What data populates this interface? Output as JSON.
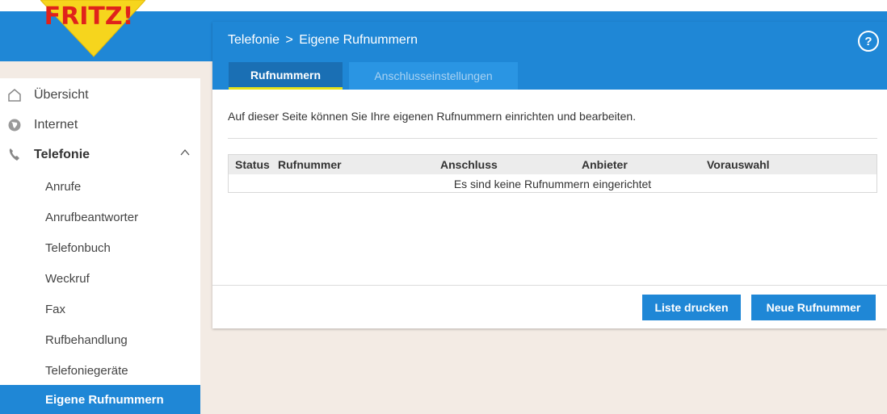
{
  "logo_text": "FRITZ!",
  "sidebar": {
    "items": [
      {
        "label": "Übersicht",
        "icon": "home-icon"
      },
      {
        "label": "Internet",
        "icon": "globe-icon"
      },
      {
        "label": "Telefonie",
        "icon": "phone-icon",
        "expanded": true
      }
    ],
    "sub_items": [
      {
        "label": "Anrufe"
      },
      {
        "label": "Anrufbeantworter"
      },
      {
        "label": "Telefonbuch"
      },
      {
        "label": "Weckruf"
      },
      {
        "label": "Fax"
      },
      {
        "label": "Rufbehandlung"
      },
      {
        "label": "Telefoniegeräte"
      },
      {
        "label": "Eigene Rufnummern",
        "active": true
      }
    ]
  },
  "header": {
    "breadcrumb_parent": "Telefonie",
    "breadcrumb_sep": ">",
    "breadcrumb_current": "Eigene Rufnummern",
    "help_label": "?"
  },
  "tabs": [
    {
      "label": "Rufnummern",
      "active": true
    },
    {
      "label": "Anschlusseinstellungen",
      "active": false
    }
  ],
  "main": {
    "intro": "Auf dieser Seite können Sie Ihre eigenen Rufnummern einrichten und bearbeiten.",
    "table": {
      "columns": [
        "Status",
        "Rufnummer",
        "Anschluss",
        "Anbieter",
        "Vorauswahl"
      ],
      "empty_message": "Es sind keine Rufnummern eingerichtet"
    }
  },
  "buttons": {
    "print": "Liste drucken",
    "new": "Neue Rufnummer"
  },
  "colors": {
    "accent": "#1f87d6",
    "tab_underline": "#e7e21a",
    "background": "#f3ebe4"
  }
}
